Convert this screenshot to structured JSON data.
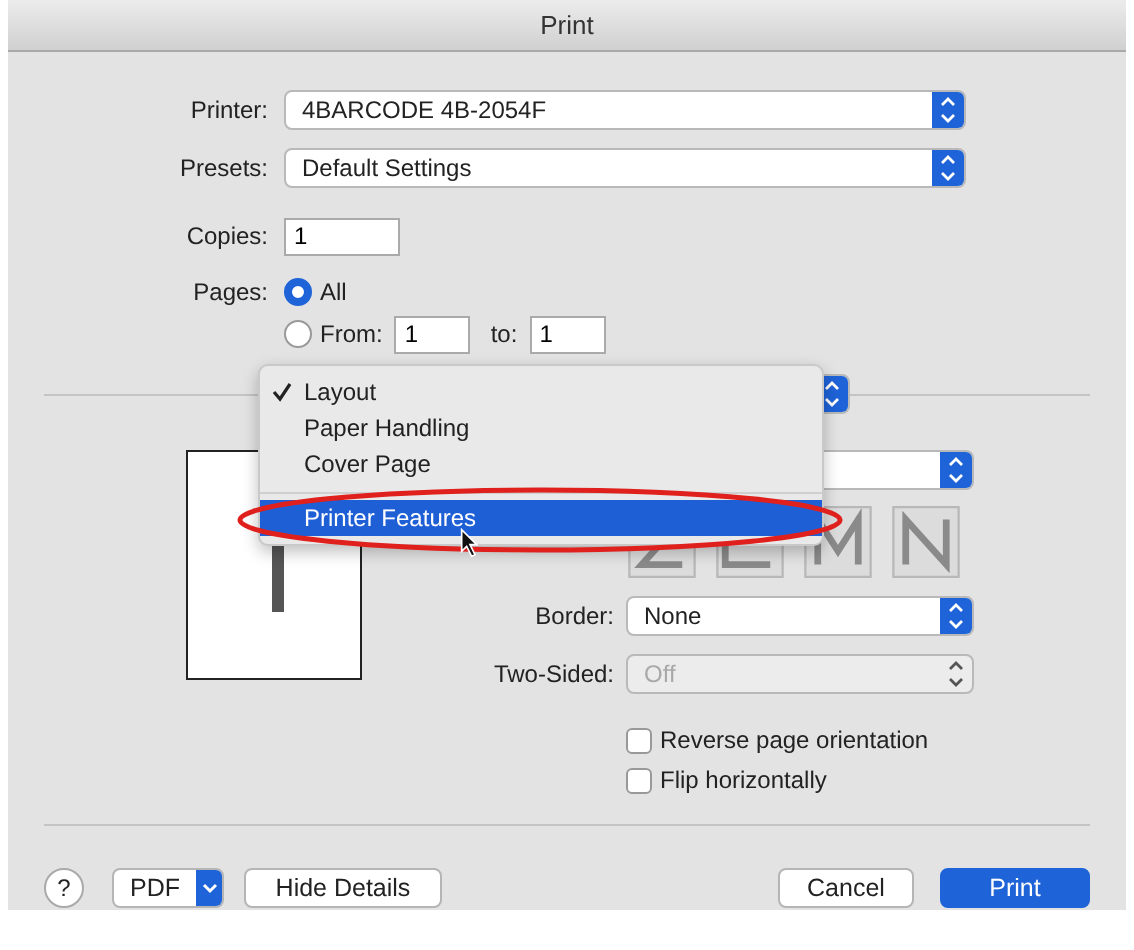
{
  "window": {
    "title": "Print"
  },
  "printer": {
    "label": "Printer:",
    "value": "4BARCODE 4B-2054F"
  },
  "presets": {
    "label": "Presets:",
    "value": "Default Settings"
  },
  "copies": {
    "label": "Copies:",
    "value": "1"
  },
  "pages": {
    "label": "Pages:",
    "options": [
      {
        "label": "All",
        "selected": true
      },
      {
        "label": "From:",
        "selected": false
      }
    ],
    "from": "1",
    "to_label": "to:",
    "to": "1"
  },
  "section_menu": {
    "groups": [
      [
        {
          "label": "Layout",
          "checked": true,
          "selected": false
        },
        {
          "label": "Paper Handling",
          "checked": false,
          "selected": false
        },
        {
          "label": "Cover Page",
          "checked": false,
          "selected": false
        }
      ],
      [
        {
          "label": "Printer Features",
          "checked": false,
          "selected": true
        }
      ]
    ]
  },
  "border": {
    "label": "Border:",
    "value": "None"
  },
  "two_sided": {
    "label": "Two-Sided:",
    "value": "Off",
    "disabled": true
  },
  "options": [
    {
      "label": "Reverse page orientation",
      "checked": false
    },
    {
      "label": "Flip horizontally",
      "checked": false
    }
  ],
  "footer": {
    "help": "?",
    "pdf": "PDF",
    "hide_details": "Hide Details",
    "cancel": "Cancel",
    "print": "Print"
  }
}
